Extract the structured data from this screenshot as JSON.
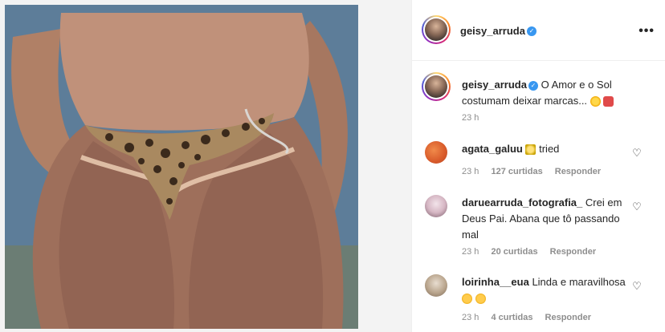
{
  "post": {
    "author": "geisy_arruda",
    "caption": "O Amor e o Sol costumam deixar marcas...",
    "caption_emojis": [
      "sun-emoji",
      "bikini-emoji"
    ],
    "time": "23 h"
  },
  "comments": [
    {
      "username": "agata_galuu",
      "text": "tried",
      "emoji_prefix": "sparkle-emoji",
      "time": "23 h",
      "likes": "127 curtidas",
      "reply": "Responder"
    },
    {
      "username": "daruearruda_fotografia_",
      "text": "Crei em Deus Pai. Abana que tô passando mal",
      "time": "23 h",
      "likes": "20 curtidas",
      "reply": "Responder"
    },
    {
      "username": "loirinha__eua",
      "text": "Linda e maravilhosa",
      "emoji_suffix": [
        "heart-eyes-emoji",
        "heart-eyes-emoji"
      ],
      "time": "23 h",
      "likes": "4 curtidas",
      "reply": "Responder"
    }
  ],
  "colors": {
    "verified": "#3897f0",
    "meta": "#8e8e8e",
    "text": "#262626"
  },
  "icons": {
    "more": "more-options-icon",
    "like": "heart-outline-icon",
    "verified": "verified-badge-icon"
  }
}
